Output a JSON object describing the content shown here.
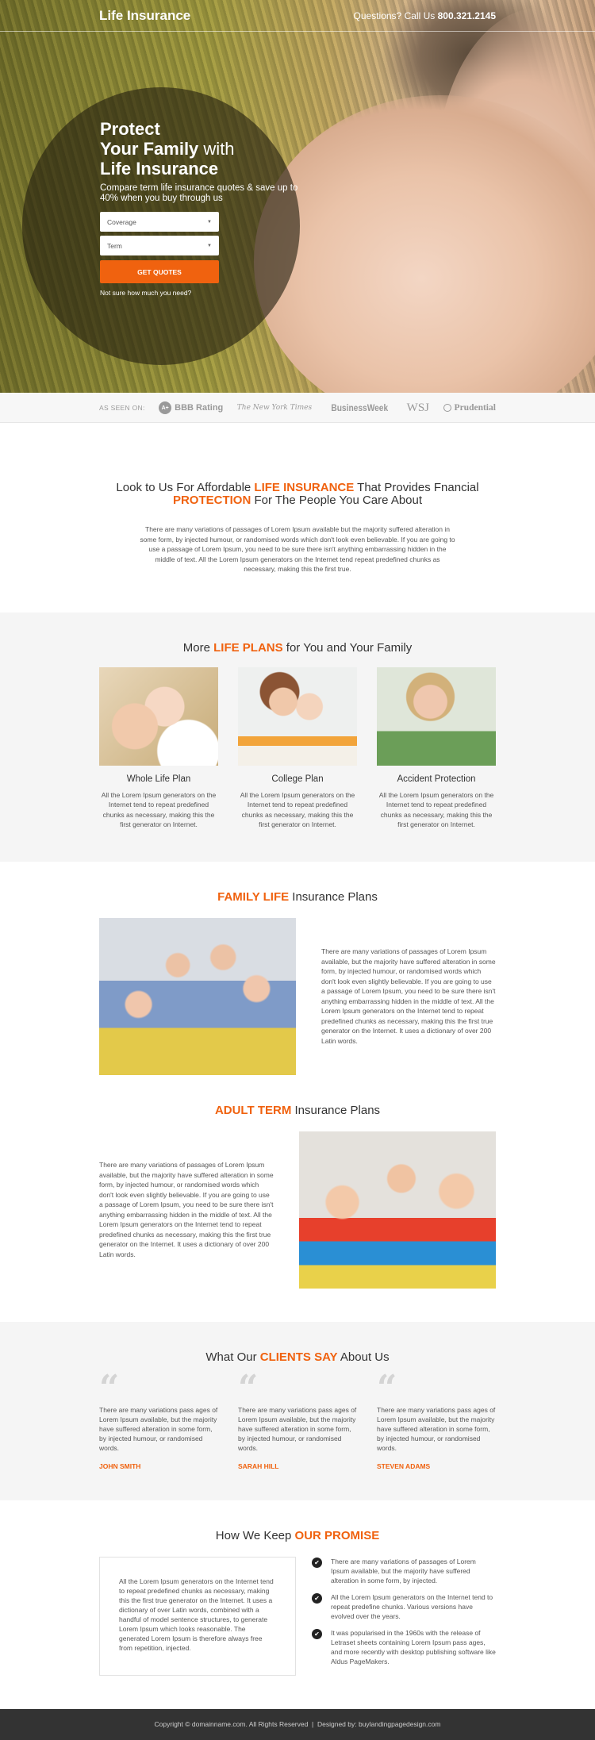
{
  "header": {
    "logo": "Life Insurance",
    "phone_prefix": "Questions? Call Us",
    "phone_number": "800.321.2145"
  },
  "hero": {
    "title_line1": "Protect",
    "title_line2_bold": "Your Family",
    "title_line2_light": "with",
    "title_line3": "Life Insurance",
    "subtitle": "Compare term life insurance quotes & save up to 40% when you buy through us",
    "coverage_select": "Coverage",
    "term_select": "Term",
    "cta": "GET QUOTES",
    "hint_link": "Not sure how much you need?"
  },
  "as_seen_on": {
    "label": "AS SEEN ON:",
    "brands": [
      {
        "badge": "A+",
        "name": "BBB Rating"
      },
      {
        "name": "The New York Times"
      },
      {
        "name": "BusinessWeek"
      },
      {
        "name": "WSJ"
      },
      {
        "name": "Prudential"
      }
    ]
  },
  "intro": {
    "h_part1": "Look to Us For Affordable",
    "h_accent1": "LIFE INSURANCE",
    "h_part2": "That Provides Fnancial",
    "h_accent2": "PROTECTION",
    "h_part3": "For The People You Care About",
    "body": "There are many variations of passages of Lorem Ipsum available but the majority suffered alteration in some form, by injected humour, or randomised words which don't look even believable. If you are going to use a passage of Lorem Ipsum, you need to be sure there isn't anything embarrassing hidden in the middle of text. All the Lorem Ipsum generators on the Internet tend repeat predefined chunks as necessary, making this the first true."
  },
  "plans": {
    "title_pre": "More",
    "title_accent": "LIFE PLANS",
    "title_post": "for You and Your Family",
    "items": [
      {
        "title": "Whole Life Plan",
        "text": "All the Lorem Ipsum generators on the Internet tend to repeat predefined chunks as necessary, making this the first generator on Internet."
      },
      {
        "title": "College Plan",
        "text": "All the Lorem Ipsum generators on the Internet tend to repeat predefined chunks as necessary, making this the first generator on Internet."
      },
      {
        "title": "Accident Protection",
        "text": "All the Lorem Ipsum generators on the Internet tend to repeat predefined chunks as necessary, making this the first generator on Internet."
      }
    ]
  },
  "family": {
    "title_accent": "FAMILY LIFE",
    "title_post": "Insurance Plans",
    "text": "There are many variations of passages of Lorem Ipsum available, but the majority have suffered alteration in some form, by injected humour, or randomised words which don't look even slightly believable. If you are going to use a passage of Lorem Ipsum, you need to be sure there isn't anything embarrassing hidden in the middle of text. All the Lorem Ipsum generators on the Internet tend to repeat predefined chunks as necessary, making this the first true generator on the Internet. It uses a dictionary of over 200 Latin words."
  },
  "adult": {
    "title_accent": "ADULT TERM",
    "title_post": "Insurance Plans",
    "text": "There are many variations of passages of Lorem Ipsum available, but the majority have suffered alteration in some form, by injected humour, or randomised words which don't look even slightly believable. If you are going to use a passage of Lorem Ipsum, you need to be sure there isn't anything embarrassing hidden in the middle of text. All the Lorem Ipsum generators on the Internet tend to repeat predefined chunks as necessary, making this the first true generator on the Internet. It uses a dictionary of over 200 Latin words."
  },
  "testimonials": {
    "title_pre": "What Our",
    "title_accent": "CLIENTS SAY",
    "title_post": "About Us",
    "quote_glyph": "“",
    "items": [
      {
        "text": "There are many variations pass ages of Lorem Ipsum available, but the majority have suffered alteration in some form, by injected humour, or randomised words.",
        "name": "JOHN SMITH"
      },
      {
        "text": "There are many variations pass ages of Lorem Ipsum available, but the majority have suffered alteration in some form, by injected humour, or randomised words.",
        "name": "SARAH HILL"
      },
      {
        "text": "There are many variations pass ages of Lorem Ipsum available, but the majority have suffered alteration in some form, by injected humour, or randomised words.",
        "name": "STEVEN ADAMS"
      }
    ]
  },
  "promise": {
    "title_pre": "How We Keep",
    "title_accent": "OUR PROMISE",
    "box_text": "All the Lorem Ipsum generators on the Internet tend to repeat predefined chunks as necessary, making this the first true generator on the Internet. It uses a dictionary of over Latin words, combined with a handful of model sentence structures, to generate Lorem Ipsum which looks reasonable. The generated Lorem Ipsum is therefore always free from repetition, injected.",
    "check_glyph": "✔",
    "points": [
      "There are many variations of passages of Lorem Ipsum available, but the majority have suffered alteration in some form, by injected.",
      "All the Lorem Ipsum generators on the Internet tend to repeat predefine chunks. Various versions have evolved over the years.",
      "It was popularised in the 1960s with the release of Letraset sheets containing Lorem Ipsum pass ages, and more recently with desktop publishing software like Aldus PageMakers."
    ]
  },
  "footer": {
    "text": "Copyright © domainname.com. All Rights Reserved  |  Designed by: buylandingpagedesign.com"
  }
}
